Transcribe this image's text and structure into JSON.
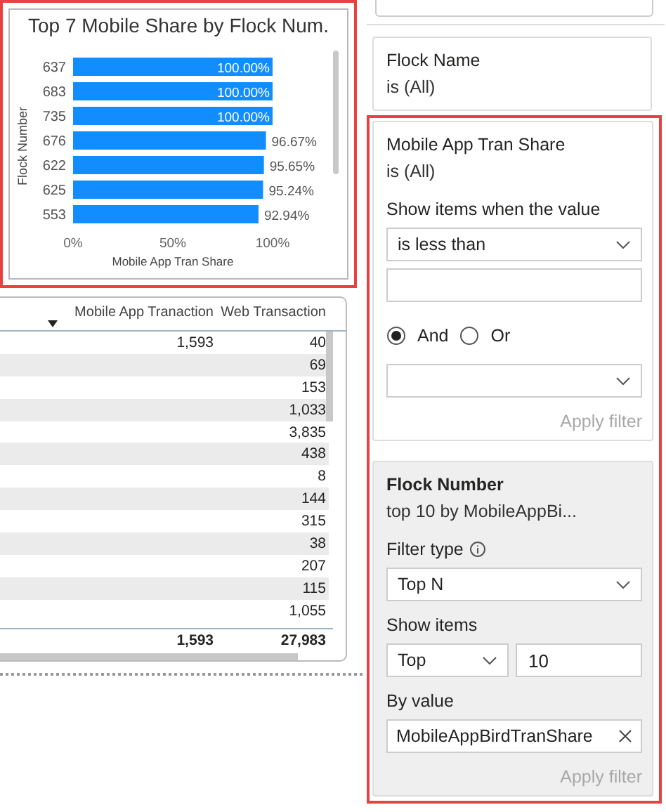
{
  "chart": {
    "highlighted": true,
    "title": "Top 7 Mobile Share by Flock Num.",
    "chart_data": {
      "type": "bar",
      "orientation": "horizontal",
      "xlabel": "Mobile App Tran Share",
      "ylabel": "Flock Number",
      "categories": [
        "637",
        "683",
        "735",
        "676",
        "622",
        "625",
        "553"
      ],
      "values": [
        100,
        100,
        100,
        96.67,
        95.65,
        95.24,
        92.94
      ],
      "value_labels": [
        "100.00%",
        "100.00%",
        "100.00%",
        "96.67%",
        "95.65%",
        "95.24%",
        "92.94%"
      ],
      "xlim": [
        0,
        100
      ],
      "xticks": [
        {
          "value": 0,
          "label": "0%"
        },
        {
          "value": 50,
          "label": "50%"
        },
        {
          "value": 100,
          "label": "100%"
        }
      ]
    }
  },
  "table": {
    "columns": [
      {
        "label": "Mobile App Tranaction",
        "sorted": true
      },
      {
        "label": "Web Transaction",
        "sorted": false
      }
    ],
    "rows": [
      {
        "mobile": "1,593",
        "web": "40"
      },
      {
        "web": "69"
      },
      {
        "web": "153"
      },
      {
        "web": "1,033"
      },
      {
        "web": "3,835"
      },
      {
        "web": "438"
      },
      {
        "web": "8"
      },
      {
        "web": "144"
      },
      {
        "web": "315"
      },
      {
        "web": "38"
      },
      {
        "web": "207"
      },
      {
        "web": "115"
      },
      {
        "web": "1,055"
      }
    ],
    "total": {
      "mobile": "1,593",
      "web": "27,983"
    }
  },
  "filters": [
    {
      "kind": "basic",
      "field": "Flock Name",
      "summary": "is (All)",
      "highlighted": false,
      "selected": false,
      "applied": false
    },
    {
      "kind": "advanced",
      "field": "Mobile App Tran Share",
      "summary": "is (All)",
      "highlighted": true,
      "selected": false,
      "applied": false,
      "condition_label": "Show items when the value",
      "operator": "is less than",
      "logic": [
        {
          "label": "And",
          "selected": true
        },
        {
          "label": "Or",
          "selected": false
        }
      ],
      "apply": {
        "label": "Apply filter",
        "disabled": true
      }
    },
    {
      "kind": "topn",
      "field": "Flock Number",
      "summary": "top 10 by MobileAppBi...",
      "highlighted": true,
      "selected": true,
      "applied": true,
      "filter_type_label": "Filter type",
      "filter_type": "Top N",
      "show_items_label": "Show items",
      "direction": "Top",
      "count": "10",
      "by_value_label": "By value",
      "by_value": "MobileAppBirdTranShare",
      "apply": {
        "label": "Apply filter",
        "disabled": true
      }
    }
  ]
}
